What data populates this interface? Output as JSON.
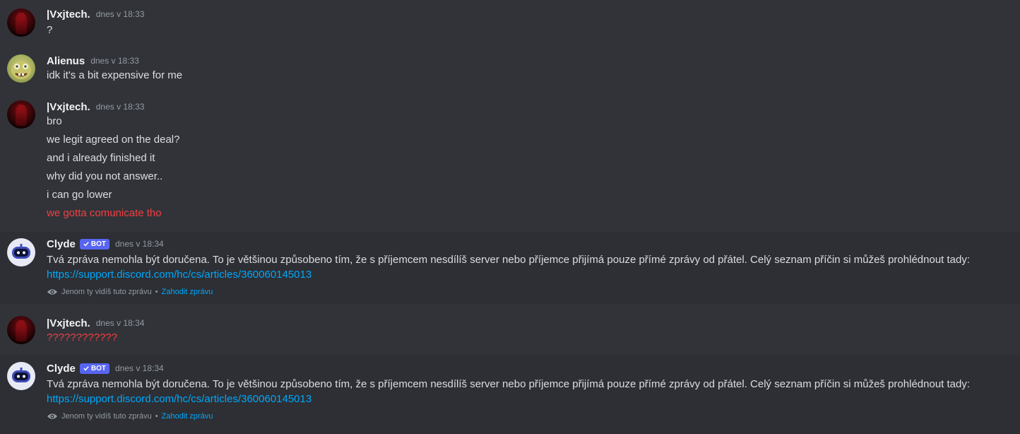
{
  "colors": {
    "background": "#313338",
    "system_background": "#2d2f34",
    "text": "#dbdee1",
    "muted": "#949ba4",
    "link": "#00a8fc",
    "failed": "#f23f43",
    "bot_tag": "#5865f2"
  },
  "messages": [
    {
      "author": "|Vxjtech.",
      "timestamp": "dnes v 18:33",
      "avatar_icon": "dark-red-avatar",
      "lines": [
        "?"
      ]
    },
    {
      "author": "Alienus",
      "timestamp": "dnes v 18:33",
      "avatar_icon": "caveman-spongebob-avatar",
      "lines": [
        "idk it's a bit expensive for me"
      ]
    },
    {
      "author": "|Vxjtech.",
      "timestamp": "dnes v 18:33",
      "avatar_icon": "dark-red-avatar",
      "lines": [
        "bro",
        "we legit agreed on the deal?",
        "and i already finished it",
        "why did you not answer..",
        "i can go lower",
        "we gotta comunicate tho"
      ],
      "failed_line_index": 5
    },
    {
      "author": "Clyde",
      "bot_tag": "BOT",
      "timestamp": "dnes v 18:34",
      "avatar_icon": "clyde-robot-avatar",
      "text": "Tvá zpráva nemohla být doručena. To je většinou způsobeno tím, že s příjemcem nesdílíš server nebo příjemce přijímá pouze přímé zprávy od přátel. Celý seznam příčin si můžeš prohlédnout tady:",
      "link": "https://support.discord.com/hc/cs/articles/360060145013",
      "ephemeral_note": "Jenom ty vidíš tuto zprávu",
      "separator": "•",
      "dismiss_label": "Zahodit zprávu"
    },
    {
      "author": "|Vxjtech.",
      "timestamp": "dnes v 18:34",
      "avatar_icon": "dark-red-avatar",
      "lines": [
        "????????????"
      ],
      "failed_line_index": 0
    },
    {
      "author": "Clyde",
      "bot_tag": "BOT",
      "timestamp": "dnes v 18:34",
      "avatar_icon": "clyde-robot-avatar",
      "text": "Tvá zpráva nemohla být doručena. To je většinou způsobeno tím, že s příjemcem nesdílíš server nebo příjemce přijímá pouze přímé zprávy od přátel. Celý seznam příčin si můžeš prohlédnout tady:",
      "link": "https://support.discord.com/hc/cs/articles/360060145013",
      "ephemeral_note": "Jenom ty vidíš tuto zprávu",
      "separator": "•",
      "dismiss_label": "Zahodit zprávu"
    }
  ]
}
